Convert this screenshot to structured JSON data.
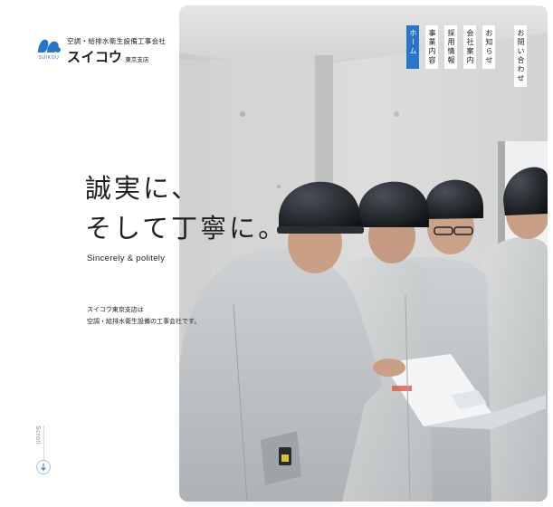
{
  "brand": {
    "logo_icon": "suikou-wave-logo",
    "logo_en": "SUIKOU",
    "tagline": "空調・給排水衛生設備工事会社",
    "name": "スイコウ",
    "branch": "東京支店",
    "color": "#2a74c7"
  },
  "nav": {
    "items": [
      {
        "label": "ホーム",
        "active": true
      },
      {
        "label": "事業内容",
        "active": false
      },
      {
        "label": "採用情報",
        "active": false
      },
      {
        "label": "会社案内",
        "active": false
      },
      {
        "label": "お知らせ",
        "active": false
      }
    ],
    "contact": "お問い合わせ",
    "accent": "#2a74c7"
  },
  "hero": {
    "headline_line1": "誠実に、",
    "headline_line2": "そして丁寧に。",
    "sub_en": "Sincerely & politely",
    "desc_line1": "スイコウ東京支店は",
    "desc_line2": "空調・給排水衛生設備の工事会社です。",
    "image": "construction-workers-reviewing-plans-photo"
  },
  "scroll": {
    "label": "Scroll",
    "icon": "arrow-down-icon"
  }
}
